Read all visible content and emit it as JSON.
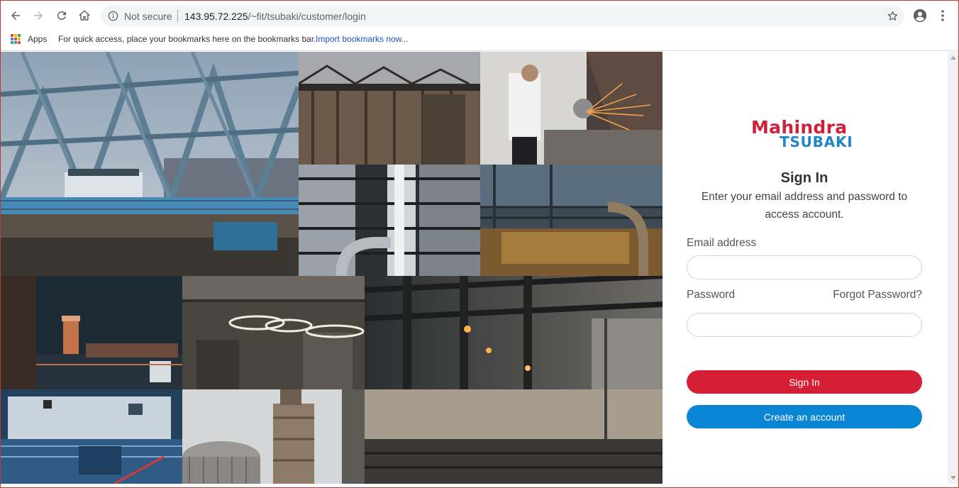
{
  "browser": {
    "security_label": "Not secure",
    "url_host": "143.95.72.225",
    "url_path": "/~fit/tsubaki/customer/login"
  },
  "bookmarks": {
    "apps_label": "Apps",
    "hint": "For quick access, place your bookmarks here on the bookmarks bar.",
    "import_link": "Import bookmarks now..."
  },
  "logo": {
    "top": "Mahindra",
    "bottom": "TSUBAKI"
  },
  "signin": {
    "title": "Sign In",
    "subtitle": "Enter your email address and password to access account.",
    "email_label": "Email address",
    "email_value": "",
    "password_label": "Password",
    "password_value": "",
    "forgot_link": "Forgot Password?",
    "signin_button": "Sign In",
    "create_button": "Create an account"
  },
  "colors": {
    "brand_red": "#d61f35",
    "brand_blue": "#0985d4",
    "logo_red": "#d0203a",
    "logo_blue": "#1f86c8"
  },
  "collage_images": [
    "steel-bridge-photo",
    "industrial-silos-photo",
    "worker-grinding-sparks-photo",
    "pipes-and-tanks-photo",
    "steel-plant-interior-photo",
    "factory-night-photo",
    "ring-lights-factory-photo",
    "factory-hall-lights-photo",
    "ship-deck-photo",
    "chimney-tower-photo"
  ]
}
